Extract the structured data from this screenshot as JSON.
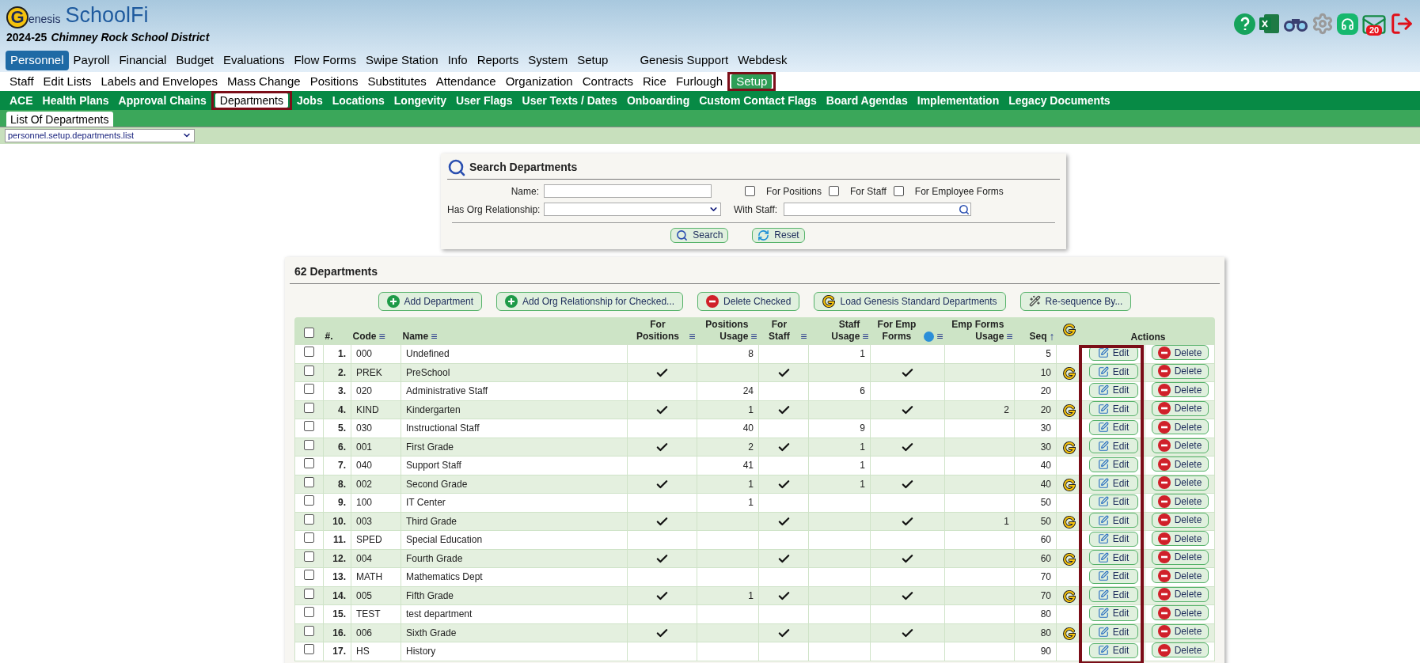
{
  "header": {
    "logo_mark": "G",
    "logo_word": "enesis",
    "product": "SchoolFi",
    "year": "2024-25",
    "district": "Chimney Rock School District",
    "mail_count": "20"
  },
  "nav_main": [
    {
      "label": "Personnel",
      "selected": true
    },
    {
      "label": "Payroll",
      "selected": false
    },
    {
      "label": "Financial",
      "selected": false
    },
    {
      "label": "Budget",
      "selected": false
    },
    {
      "label": "Evaluations",
      "selected": false
    },
    {
      "label": "Flow Forms",
      "selected": false
    },
    {
      "label": "Swipe Station",
      "selected": false
    },
    {
      "label": "Info",
      "selected": false
    },
    {
      "label": "Reports",
      "selected": false
    },
    {
      "label": "System",
      "selected": false
    },
    {
      "label": "Setup",
      "selected": false
    },
    {
      "label": "Genesis Support",
      "selected": false
    },
    {
      "label": "Webdesk",
      "selected": false
    }
  ],
  "nav_sub": [
    {
      "label": "Staff",
      "selected": false,
      "highlighted": false
    },
    {
      "label": "Edit Lists",
      "selected": false,
      "highlighted": false
    },
    {
      "label": "Labels and Envelopes",
      "selected": false,
      "highlighted": false
    },
    {
      "label": "Mass Change",
      "selected": false,
      "highlighted": false
    },
    {
      "label": "Positions",
      "selected": false,
      "highlighted": false
    },
    {
      "label": "Substitutes",
      "selected": false,
      "highlighted": false
    },
    {
      "label": "Attendance",
      "selected": false,
      "highlighted": false
    },
    {
      "label": "Organization",
      "selected": false,
      "highlighted": false
    },
    {
      "label": "Contracts",
      "selected": false,
      "highlighted": false
    },
    {
      "label": "Rice",
      "selected": false,
      "highlighted": false
    },
    {
      "label": "Furlough",
      "selected": false,
      "highlighted": false
    },
    {
      "label": "Setup",
      "selected": true,
      "highlighted": true
    }
  ],
  "nav_setup": [
    {
      "label": "ACE",
      "selected": false,
      "highlighted": false
    },
    {
      "label": "Health Plans",
      "selected": false,
      "highlighted": false
    },
    {
      "label": "Approval Chains",
      "selected": false,
      "highlighted": false
    },
    {
      "label": "Departments",
      "selected": true,
      "highlighted": true
    },
    {
      "label": "Jobs",
      "selected": false,
      "highlighted": false
    },
    {
      "label": "Locations",
      "selected": false,
      "highlighted": false
    },
    {
      "label": "Longevity",
      "selected": false,
      "highlighted": false
    },
    {
      "label": "User Flags",
      "selected": false,
      "highlighted": false
    },
    {
      "label": "User Texts / Dates",
      "selected": false,
      "highlighted": false
    },
    {
      "label": "Onboarding",
      "selected": false,
      "highlighted": false
    },
    {
      "label": "Custom Contact Flags",
      "selected": false,
      "highlighted": false
    },
    {
      "label": "Board Agendas",
      "selected": false,
      "highlighted": false
    },
    {
      "label": "Implementation",
      "selected": false,
      "highlighted": false
    },
    {
      "label": "Legacy Documents",
      "selected": false,
      "highlighted": false
    }
  ],
  "nav_page": [
    {
      "label": "List Of Departments",
      "selected": true
    }
  ],
  "page_select": {
    "value": "personnel.setup.departments.list"
  },
  "search": {
    "title": "Search Departments",
    "name_label": "Name:",
    "org_label": "Has Org Relationship:",
    "staff_label": "With Staff:",
    "flags": [
      {
        "label": "For Positions",
        "checked": false
      },
      {
        "label": "For Staff",
        "checked": false
      },
      {
        "label": "For Employee Forms",
        "checked": false
      }
    ],
    "buttons": [
      {
        "label": "Search",
        "kind": "search"
      },
      {
        "label": "Reset",
        "kind": "reset"
      }
    ]
  },
  "list": {
    "title": "62 Departments",
    "highlight_edit_column": true,
    "buttons": [
      {
        "label": "Add Department",
        "kind": "add"
      },
      {
        "label": "Add Org Relationship for Checked...",
        "kind": "add"
      },
      {
        "label": "Delete Checked",
        "kind": "delete"
      },
      {
        "label": "Load Genesis Standard Departments",
        "kind": "genesis"
      },
      {
        "label": "Re-sequence By...",
        "kind": "wand"
      }
    ],
    "header_checked": false,
    "columns": [
      {
        "label": "#.",
        "kind": "num"
      },
      {
        "label": "Code",
        "kind": "text",
        "sort": "≡"
      },
      {
        "label": "Name",
        "kind": "text",
        "sort": "≡"
      },
      {
        "label": "For Positions",
        "kind": "flag",
        "sort": "≡"
      },
      {
        "label": "Positions Usage",
        "kind": "number",
        "sort": "≡"
      },
      {
        "label": "For Staff",
        "kind": "flag",
        "sort": "≡"
      },
      {
        "label": "Staff Usage",
        "kind": "number",
        "sort": "≡"
      },
      {
        "label": "For Emp Forms",
        "kind": "flag",
        "sort": "≡",
        "info": true
      },
      {
        "label": "Emp Forms Usage",
        "kind": "number",
        "sort": "≡"
      },
      {
        "label": "Seq",
        "kind": "number",
        "sort": "↑"
      },
      {
        "kind": "genesis"
      },
      {
        "label": "Actions",
        "kind": "actions"
      }
    ],
    "rows": [
      {
        "num": "1.",
        "code": "000",
        "name": "Undefined",
        "for_positions": false,
        "positions_usage": "8",
        "for_staff": false,
        "staff_usage": "1",
        "for_emp_forms": false,
        "seq": "5",
        "genesis": false,
        "checked": false,
        "edit": "Edit",
        "delete": "Delete"
      },
      {
        "num": "2.",
        "code": "PREK",
        "name": "PreSchool",
        "for_positions": true,
        "for_staff": true,
        "for_emp_forms": true,
        "seq": "10",
        "genesis": true,
        "checked": false,
        "edit": "Edit",
        "delete": "Delete"
      },
      {
        "num": "3.",
        "code": "020",
        "name": "Administrative Staff",
        "for_positions": false,
        "positions_usage": "24",
        "for_staff": false,
        "staff_usage": "6",
        "for_emp_forms": false,
        "seq": "20",
        "genesis": false,
        "checked": false,
        "edit": "Edit",
        "delete": "Delete"
      },
      {
        "num": "4.",
        "code": "KIND",
        "name": "Kindergarten",
        "for_positions": true,
        "positions_usage": "1",
        "for_staff": true,
        "for_emp_forms": true,
        "emp_forms_usage": "2",
        "seq": "20",
        "genesis": true,
        "checked": false,
        "edit": "Edit",
        "delete": "Delete"
      },
      {
        "num": "5.",
        "code": "030",
        "name": "Instructional Staff",
        "for_positions": false,
        "positions_usage": "40",
        "for_staff": false,
        "staff_usage": "9",
        "for_emp_forms": false,
        "seq": "30",
        "genesis": false,
        "checked": false,
        "edit": "Edit",
        "delete": "Delete"
      },
      {
        "num": "6.",
        "code": "001",
        "name": "First Grade",
        "for_positions": true,
        "positions_usage": "2",
        "for_staff": true,
        "staff_usage": "1",
        "for_emp_forms": true,
        "seq": "30",
        "genesis": true,
        "checked": false,
        "edit": "Edit",
        "delete": "Delete"
      },
      {
        "num": "7.",
        "code": "040",
        "name": "Support Staff",
        "for_positions": false,
        "positions_usage": "41",
        "for_staff": false,
        "staff_usage": "1",
        "for_emp_forms": false,
        "seq": "40",
        "genesis": false,
        "checked": false,
        "edit": "Edit",
        "delete": "Delete"
      },
      {
        "num": "8.",
        "code": "002",
        "name": "Second Grade",
        "for_positions": true,
        "positions_usage": "1",
        "for_staff": true,
        "staff_usage": "1",
        "for_emp_forms": true,
        "seq": "40",
        "genesis": true,
        "checked": false,
        "edit": "Edit",
        "delete": "Delete"
      },
      {
        "num": "9.",
        "code": "100",
        "name": "IT Center",
        "for_positions": false,
        "positions_usage": "1",
        "for_staff": false,
        "for_emp_forms": false,
        "seq": "50",
        "genesis": false,
        "checked": false,
        "edit": "Edit",
        "delete": "Delete"
      },
      {
        "num": "10.",
        "code": "003",
        "name": "Third Grade",
        "for_positions": true,
        "for_staff": true,
        "for_emp_forms": true,
        "emp_forms_usage": "1",
        "seq": "50",
        "genesis": true,
        "checked": false,
        "edit": "Edit",
        "delete": "Delete"
      },
      {
        "num": "11.",
        "code": "SPED",
        "name": "Special Education",
        "for_positions": false,
        "for_staff": false,
        "for_emp_forms": false,
        "seq": "60",
        "genesis": false,
        "checked": false,
        "edit": "Edit",
        "delete": "Delete"
      },
      {
        "num": "12.",
        "code": "004",
        "name": "Fourth Grade",
        "for_positions": true,
        "for_staff": true,
        "for_emp_forms": true,
        "seq": "60",
        "genesis": true,
        "checked": false,
        "edit": "Edit",
        "delete": "Delete"
      },
      {
        "num": "13.",
        "code": "MATH",
        "name": "Mathematics Dept",
        "for_positions": false,
        "for_staff": false,
        "for_emp_forms": false,
        "seq": "70",
        "genesis": false,
        "checked": false,
        "edit": "Edit",
        "delete": "Delete"
      },
      {
        "num": "14.",
        "code": "005",
        "name": "Fifth Grade",
        "for_positions": true,
        "positions_usage": "1",
        "for_staff": true,
        "for_emp_forms": true,
        "seq": "70",
        "genesis": true,
        "checked": false,
        "edit": "Edit",
        "delete": "Delete"
      },
      {
        "num": "15.",
        "code": "TEST",
        "name": "test department",
        "for_positions": false,
        "for_staff": false,
        "for_emp_forms": false,
        "seq": "80",
        "genesis": false,
        "checked": false,
        "edit": "Edit",
        "delete": "Delete"
      },
      {
        "num": "16.",
        "code": "006",
        "name": "Sixth Grade",
        "for_positions": true,
        "for_staff": true,
        "for_emp_forms": true,
        "seq": "80",
        "genesis": true,
        "checked": false,
        "edit": "Edit",
        "delete": "Delete"
      },
      {
        "num": "17.",
        "code": "HS",
        "name": "History",
        "for_positions": false,
        "for_staff": false,
        "for_emp_forms": false,
        "seq": "90",
        "genesis": false,
        "checked": false,
        "edit": "Edit",
        "delete": "Delete"
      }
    ]
  }
}
